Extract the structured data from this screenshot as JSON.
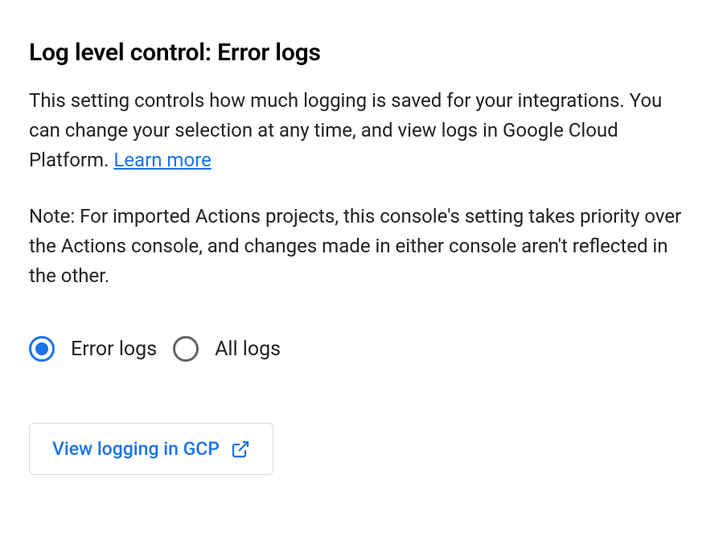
{
  "heading": "Log level control: Error logs",
  "description_part1": "This setting controls how much logging is saved for your integrations. You can change your selection at any time, and view logs in Google Cloud Platform. ",
  "learn_more": "Learn more",
  "note": "Note: For imported Actions projects, this console's setting takes priority over the Actions console, and changes made in either console aren't reflected in the other.",
  "radio_options": {
    "error_logs": "Error logs",
    "all_logs": "All logs"
  },
  "view_logging_button": "View logging in GCP"
}
